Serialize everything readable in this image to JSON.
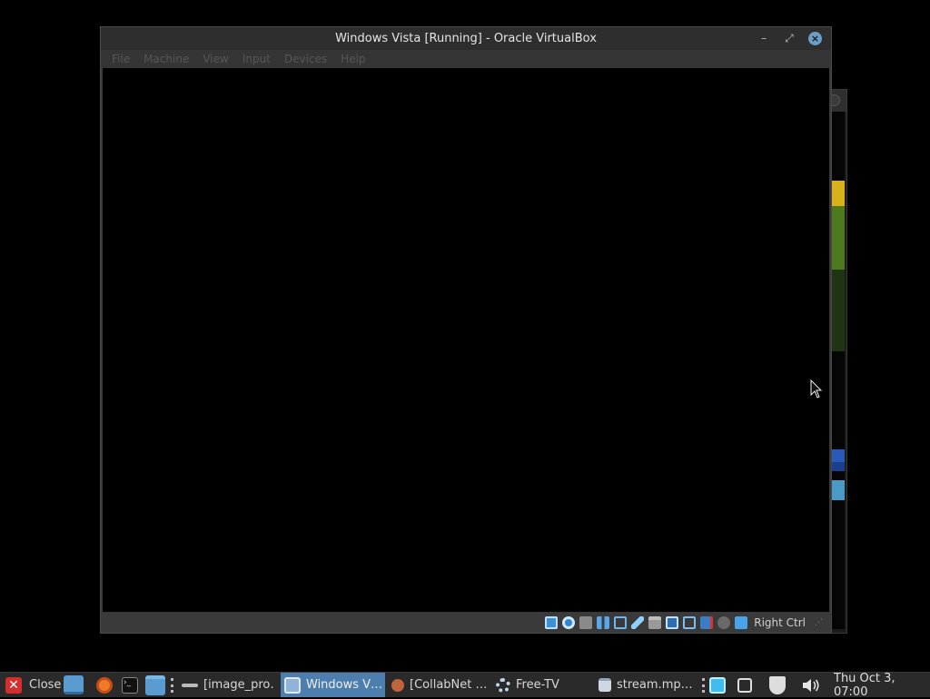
{
  "vm_window": {
    "title": "Windows Vista [Running] - Oracle VirtualBox",
    "controls": {
      "minimize": "–",
      "restore": "⤢",
      "close": "×"
    },
    "menus": [
      "File",
      "Machine",
      "View",
      "Input",
      "Devices",
      "Help"
    ],
    "status": {
      "host_key": "Right Ctrl"
    }
  },
  "taskbar": {
    "close_label": "Close",
    "tasks": [
      {
        "label": "[image_pro…",
        "active": false
      },
      {
        "label": "Windows V…",
        "active": true
      },
      {
        "label": "[CollabNet …",
        "active": false
      },
      {
        "label": "Free-TV",
        "active": false
      },
      {
        "label": "stream.mp…",
        "active": false
      }
    ],
    "clock": "Thu Oct  3, 07:00"
  },
  "colors": {
    "accent": "#4d7fae",
    "close_red": "#d32f2f",
    "firefox_orange": "#f07a2a"
  }
}
